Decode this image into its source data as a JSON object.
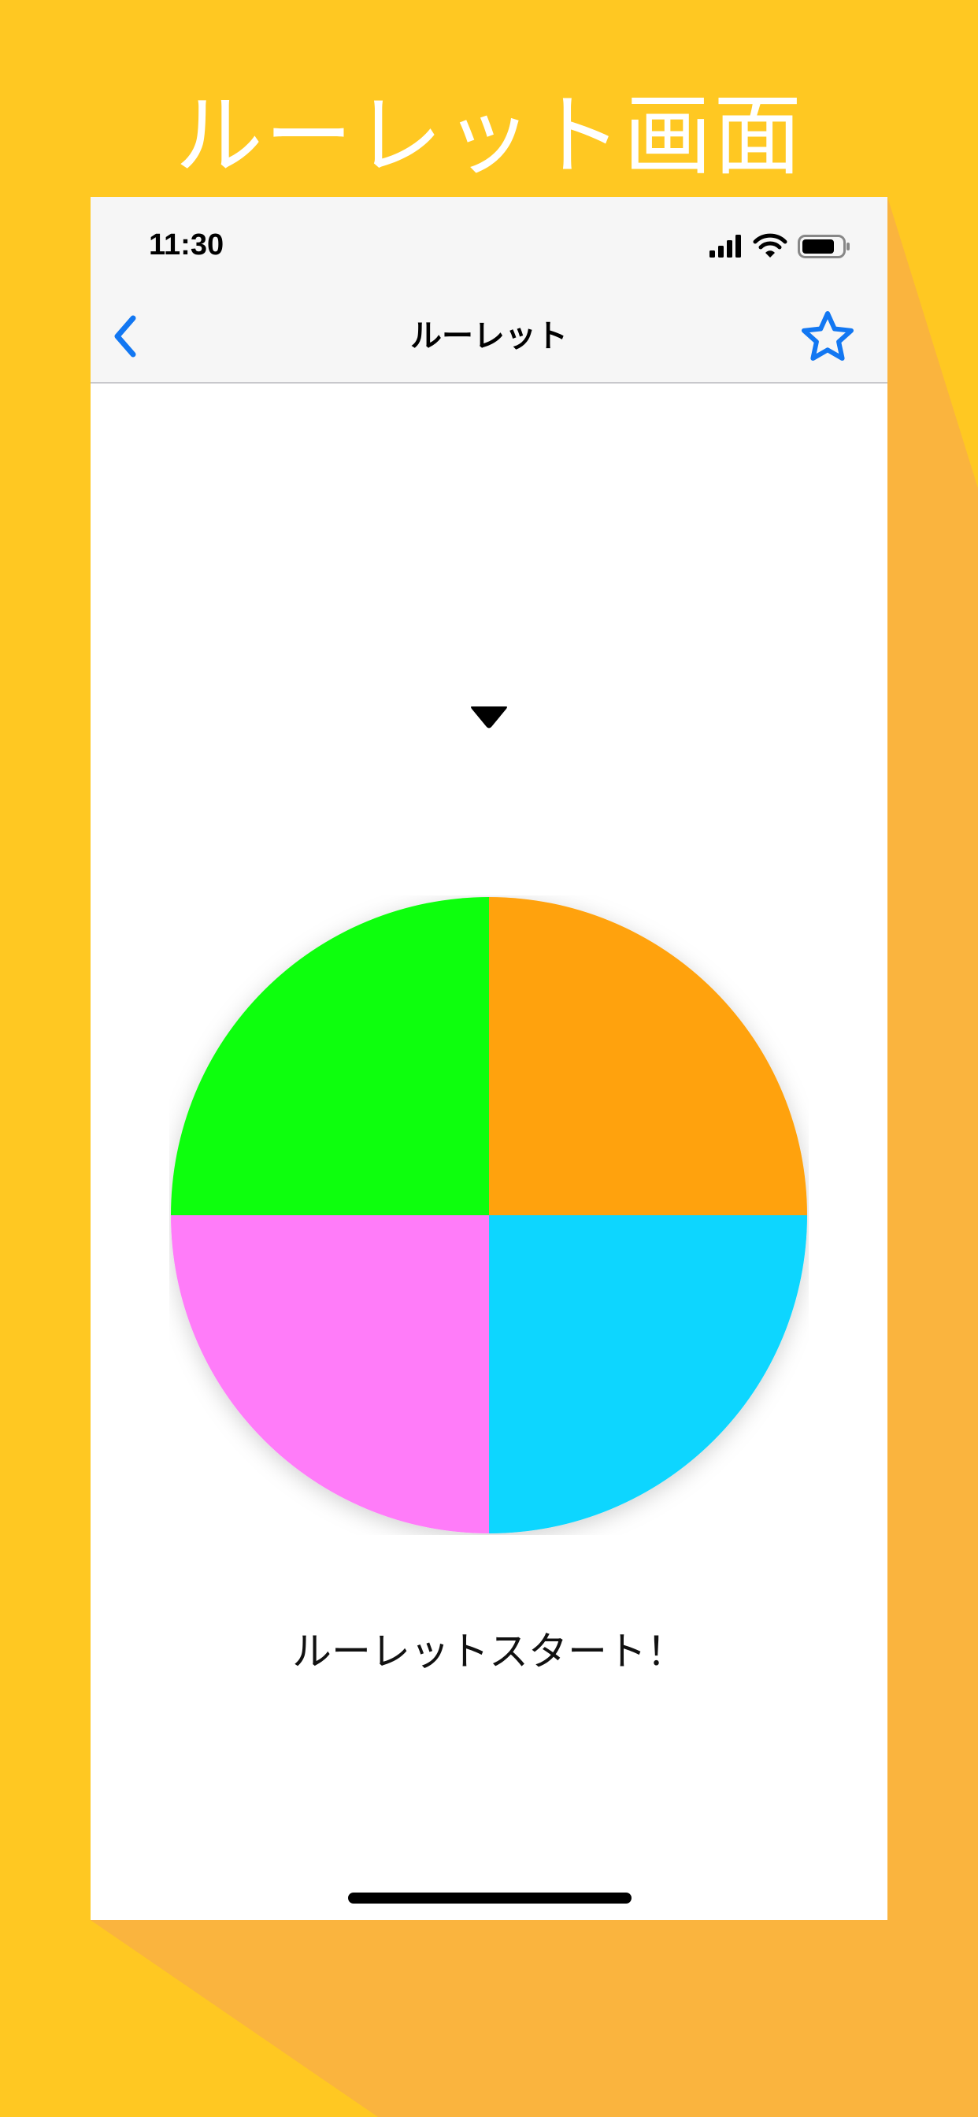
{
  "promo": {
    "title": "ルーレット画面"
  },
  "status_bar": {
    "time": "11:30",
    "icons": [
      "signal-icon",
      "wifi-icon",
      "battery-icon"
    ]
  },
  "nav": {
    "title": "ルーレット",
    "back_icon": "chevron-left-icon",
    "favorite_icon": "star-outline-icon"
  },
  "roulette": {
    "segments": [
      {
        "color": "#FFA20A"
      },
      {
        "color": "#07D6FF"
      },
      {
        "color": "#FF7CF9"
      },
      {
        "color": "#10FF0B"
      }
    ],
    "start_label": "ルーレットスタート！"
  },
  "colors": {
    "background": "#FFC822",
    "shadow": "#FAB43E",
    "accent": "#1277F2"
  }
}
